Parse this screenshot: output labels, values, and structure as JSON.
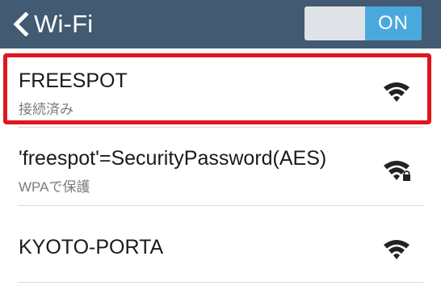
{
  "header": {
    "title": "Wi-Fi",
    "toggle_label": "ON"
  },
  "networks": [
    {
      "name": "FREESPOT",
      "status": "接続済み",
      "icon": "wifi-icon",
      "locked": false
    },
    {
      "name": "'freespot'=SecurityPassword(AES)",
      "status": "WPAで保護",
      "icon": "wifi-lock-icon",
      "locked": true
    },
    {
      "name": "KYOTO-PORTA",
      "status": "",
      "icon": "wifi-icon",
      "locked": false
    }
  ],
  "colors": {
    "header_bg": "#425a72",
    "toggle_on": "#4aa9dc",
    "highlight": "#e0161e"
  }
}
